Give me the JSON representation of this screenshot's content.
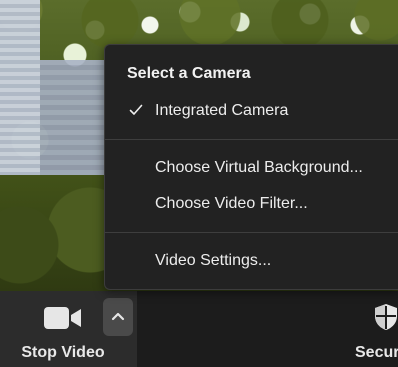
{
  "camera_menu": {
    "heading": "Select a Camera",
    "cameras": [
      {
        "label": "Integrated Camera",
        "selected": true
      }
    ],
    "actions": [
      {
        "label": "Choose Virtual Background..."
      },
      {
        "label": "Choose Video Filter..."
      }
    ],
    "settings": {
      "label": "Video Settings..."
    }
  },
  "toolbar": {
    "stop_video_label": "Stop Video",
    "security_label": "Security"
  },
  "icons": {
    "camera": "camera-icon",
    "chevron": "chevron-up-icon",
    "check": "check-icon",
    "shield": "shield-icon"
  },
  "colors": {
    "menu_bg": "#222222",
    "toolbar_bg": "#1c1c1c",
    "text": "#ededed"
  }
}
